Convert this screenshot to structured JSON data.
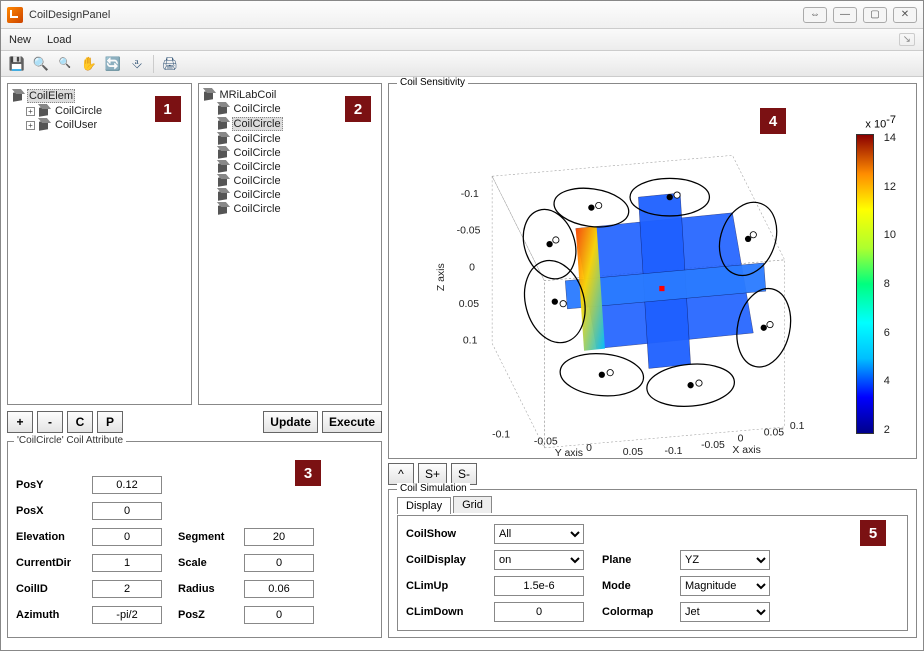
{
  "window": {
    "title": "CoilDesignPanel"
  },
  "menu": {
    "new": "New",
    "load": "Load"
  },
  "tree1": {
    "root": "CoilElem",
    "items": [
      "CoilCircle",
      "CoilUser"
    ]
  },
  "tree2": {
    "root": "MRiLabCoil",
    "items": [
      "CoilCircle",
      "CoilCircle",
      "CoilCircle",
      "CoilCircle",
      "CoilCircle",
      "CoilCircle",
      "CoilCircle",
      "CoilCircle"
    ],
    "selected_index": 1
  },
  "tree_buttons": {
    "add": "+",
    "remove": "-",
    "copy": "C",
    "paste": "P",
    "update": "Update",
    "execute": "Execute"
  },
  "attr": {
    "legend": "'CoilCircle' Coil Attribute",
    "PosY_label": "PosY",
    "PosY": "0.12",
    "PosX_label": "PosX",
    "PosX": "0",
    "Elevation_label": "Elevation",
    "Elevation": "0",
    "CurrentDir_label": "CurrentDir",
    "CurrentDir": "1",
    "CoilID_label": "CoilID",
    "CoilID": "2",
    "Azimuth_label": "Azimuth",
    "Azimuth": "-pi/2",
    "Segment_label": "Segment",
    "Segment": "20",
    "Scale_label": "Scale",
    "Scale": "0",
    "Radius_label": "Radius",
    "Radius": "0.06",
    "PosZ_label": "PosZ",
    "PosZ": "0"
  },
  "plot": {
    "legend": "Coil Sensitivity",
    "xlabel": "X axis",
    "ylabel": "Y axis",
    "zlabel": "Z axis",
    "cb_exp": "x 10",
    "cb_exp_sup": "-7",
    "cb_ticks": [
      "14",
      "12",
      "10",
      "8",
      "6",
      "4",
      "2"
    ],
    "buttons": {
      "up": "^",
      "splus": "S+",
      "sminus": "S-"
    },
    "ticks": [
      "-0.1",
      "-0.05",
      "0",
      "0.05",
      "0.1"
    ]
  },
  "sim": {
    "legend": "Coil Simulation",
    "tabs": {
      "display": "Display",
      "grid": "Grid"
    },
    "CoilShow_label": "CoilShow",
    "CoilShow": "All",
    "CoilDisplay_label": "CoilDisplay",
    "CoilDisplay": "on",
    "CLimUp_label": "CLimUp",
    "CLimUp": "1.5e-6",
    "CLimDown_label": "CLimDown",
    "CLimDown": "0",
    "Plane_label": "Plane",
    "Plane": "YZ",
    "Mode_label": "Mode",
    "Mode": "Magnitude",
    "Colormap_label": "Colormap",
    "Colormap": "Jet"
  },
  "badges": {
    "b1": "1",
    "b2": "2",
    "b3": "3",
    "b4": "4",
    "b5": "5"
  },
  "chart_data": {
    "type": "3d-slice-plot",
    "title": "Coil Sensitivity",
    "xlabel": "X axis",
    "ylabel": "Y axis",
    "zlabel": "Z axis",
    "xlim": [
      -0.1,
      0.1
    ],
    "ylim": [
      -0.1,
      0.1
    ],
    "zlim": [
      -0.1,
      0.1
    ],
    "x_ticks": [
      -0.1,
      -0.05,
      0,
      0.05,
      0.1
    ],
    "y_ticks": [
      -0.1,
      -0.05,
      0,
      0.05,
      0.1
    ],
    "z_ticks": [
      -0.1,
      -0.05,
      0,
      0.05,
      0.1
    ],
    "colorbar": {
      "range": [
        0,
        1.5e-06
      ],
      "ticks_e7": [
        2,
        4,
        6,
        8,
        10,
        12,
        14
      ],
      "colormap": "Jet"
    },
    "coil_rings": 8,
    "slice_planes": [
      "XY",
      "XZ",
      "YZ"
    ]
  }
}
